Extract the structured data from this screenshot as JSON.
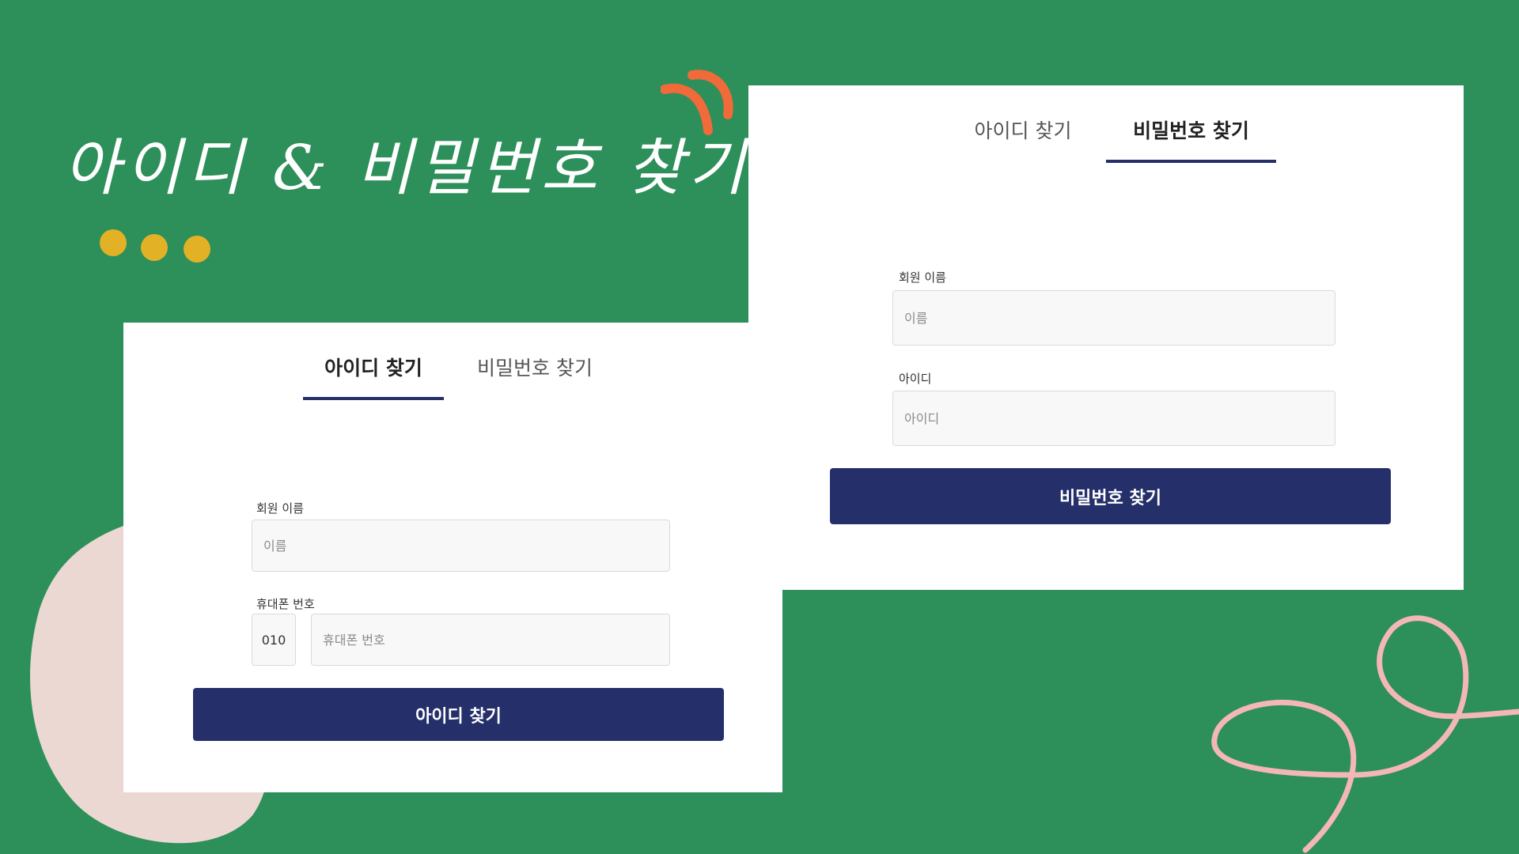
{
  "banner": {
    "title": "아이디 & 비밀번호 찾기"
  },
  "colors": {
    "background": "#2d8f5a",
    "card": "#ffffff",
    "accent": "#25306a",
    "dots": "#e2b126",
    "orange_mark": "#f06a3a",
    "pink_blob": "#ecd8d3",
    "pink_loop": "#f4b7b7"
  },
  "find_id_card": {
    "tabs": [
      {
        "label": "아이디 찾기",
        "active": true
      },
      {
        "label": "비밀번호 찾기",
        "active": false
      }
    ],
    "name_label": "회원 이름",
    "name_placeholder": "이름",
    "phone_label": "휴대폰 번호",
    "phone_prefix": "010",
    "phone_placeholder": "휴대폰 번호",
    "submit_label": "아이디 찾기"
  },
  "find_pw_card": {
    "tabs": [
      {
        "label": "아이디 찾기",
        "active": false
      },
      {
        "label": "비밀번호 찾기",
        "active": true
      }
    ],
    "name_label": "회원 이름",
    "name_placeholder": "이름",
    "id_label": "아이디",
    "id_placeholder": "아이디",
    "submit_label": "비밀번호 찾기"
  }
}
